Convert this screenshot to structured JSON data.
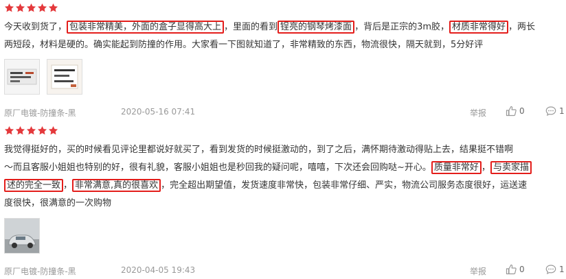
{
  "reviews": [
    {
      "rating": 5,
      "segments_line1": [
        {
          "t": "今天收到货了，",
          "hl": false
        },
        {
          "t": "包装非常精美，外面的盒子显得高大上",
          "hl": true
        },
        {
          "t": "，里面的看到",
          "hl": false
        },
        {
          "t": "锃亮的钢琴烤漆面",
          "hl": true
        },
        {
          "t": "，背后是正宗的3m胶，",
          "hl": false
        },
        {
          "t": "材质非常得好",
          "hl": true
        },
        {
          "t": "，两长",
          "hl": false
        }
      ],
      "line2": "两短段，材料是硬的。确实能起到防撞的作用。大家看一下图就知道了，非常精致的东西，物流很快，隔天就到，5分好评",
      "images": [
        "photo-1",
        "photo-2"
      ],
      "variant": "原厂电镀-防撞条-黑",
      "date": "2020-05-16 07:41",
      "report": "举报",
      "likes": "0",
      "comments": "1"
    },
    {
      "rating": 5,
      "line1": "我觉得挺好的，买的时候看见评论里都说好就买了，看到发货的时候挺激动的，到了之后，满怀期待激动得贴上去，结果挺不错啊",
      "segments_line2": [
        {
          "t": "～而且客服小姐姐也特别的好，很有礼貌，客服小姐姐也是秒回我的疑问呢，嘻嘻，下次还会回购哒~开心。",
          "hl": false
        },
        {
          "t": "质量非常好",
          "hl": true
        },
        {
          "t": "，",
          "hl": false
        },
        {
          "t": "与卖家描",
          "hl": true
        }
      ],
      "segments_line3": [
        {
          "t": "述的完全一致",
          "hl": true
        },
        {
          "t": "，",
          "hl": false
        },
        {
          "t": "非常满意,真的很喜欢",
          "hl": true
        },
        {
          "t": "，完全超出期望值，发货速度非常快，包装非常仔细、严实，物流公司服务态度很好，运送速",
          "hl": false
        }
      ],
      "line4": "度很快，很满意的一次购物",
      "images": [
        "photo-car"
      ],
      "variant": "原厂电镀-防撞条-黑",
      "date": "2020-04-05 19:43",
      "report": "举报",
      "likes": "0",
      "comments": "1"
    }
  ],
  "colors": {
    "star": "#e4393c",
    "highlight_box": "#e31d1a",
    "meta_text": "#999999"
  },
  "icons": {
    "star": "star-icon",
    "like": "thumbs-up-icon",
    "comment": "comment-icon"
  }
}
